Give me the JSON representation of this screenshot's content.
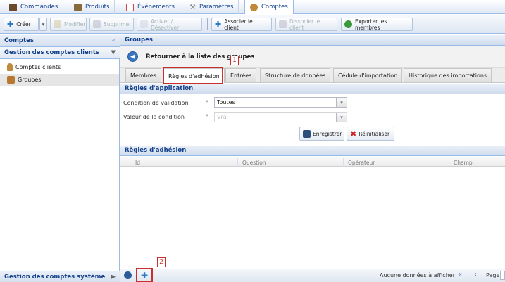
{
  "topnav": {
    "tabs": [
      {
        "label": "Commandes",
        "icon": "orders-icon"
      },
      {
        "label": "Produits",
        "icon": "products-icon"
      },
      {
        "label": "Événements",
        "icon": "calendar-icon"
      },
      {
        "label": "Paramètres",
        "icon": "wrench-icon"
      },
      {
        "label": "Comptes",
        "icon": "accounts-icon",
        "active": true
      }
    ]
  },
  "toolbar": {
    "create": "Créer",
    "modify": "Modifier",
    "delete": "Supprimer",
    "toggle": "Activer / Désactiver",
    "associate": "Associer le client",
    "dissociate": "Dissocier le client",
    "export": "Exporter les membres"
  },
  "left": {
    "title": "Comptes",
    "collapse_glyph": "«",
    "section": "Gestion des comptes clients",
    "items": [
      {
        "label": "Comptes clients"
      },
      {
        "label": "Groupes",
        "selected": true
      }
    ],
    "bottom_section": "Gestion des comptes système"
  },
  "right": {
    "title": "Groupes",
    "back": "Retourner à la liste des groupes",
    "tabs": [
      "Membres",
      "Règles d'adhésion",
      "Entrées",
      "Structure de données",
      "Cédule d'importation",
      "Historique des importations"
    ],
    "app_rules": {
      "title": "Règles d'application",
      "validation_label": "Condition de validation",
      "validation_value": "Toutes",
      "condition_label": "Valeur de la condition",
      "condition_value": "Vrai",
      "save": "Enregistrer",
      "reset": "Réinitialiser"
    },
    "membership": {
      "title": "Règles d'adhésion",
      "columns": [
        "Id",
        "Question",
        "Opérateur",
        "Champ"
      ]
    },
    "footer": {
      "empty": "Aucune données à afficher",
      "page": "Page"
    }
  },
  "annotations": {
    "label1": "1",
    "label2": "2"
  },
  "colors": {
    "accent": "#15428b",
    "border": "#99bbe8",
    "highlight": "#c9302c"
  }
}
